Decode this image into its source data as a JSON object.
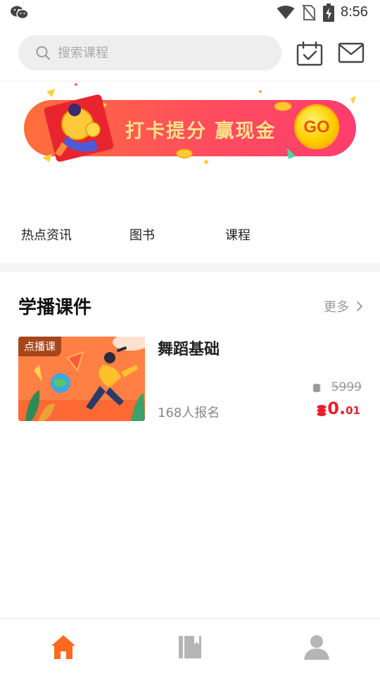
{
  "status_bar": {
    "time": "8:56",
    "icons": [
      "wechat-icon",
      "wifi-icon",
      "no-sim-icon",
      "battery-charging-icon"
    ]
  },
  "header": {
    "search": {
      "placeholder": "搜索课程",
      "icon": "search-icon"
    },
    "calendar_icon": "calendar-check-icon",
    "mail_icon": "mail-icon"
  },
  "banner": {
    "text": "打卡提分 赢现金",
    "go_label": "GO"
  },
  "tabs": [
    {
      "label": "热点资讯"
    },
    {
      "label": "图书"
    },
    {
      "label": "课程"
    }
  ],
  "section": {
    "title": "学播课件",
    "more_label": "更多"
  },
  "course": {
    "badge": "点播课",
    "title": "舞蹈基础",
    "enrolled": "168人报名",
    "original_price": "5999",
    "price_main": "0.",
    "price_decimal": "01"
  },
  "bottom_nav": [
    {
      "icon": "home-icon",
      "active": true
    },
    {
      "icon": "book-icon",
      "active": false
    },
    {
      "icon": "user-icon",
      "active": false
    }
  ],
  "colors": {
    "accent": "#ff6a1e",
    "price": "#e8202a",
    "banner_start": "#ff6f3c",
    "banner_end": "#ff3d6e"
  }
}
